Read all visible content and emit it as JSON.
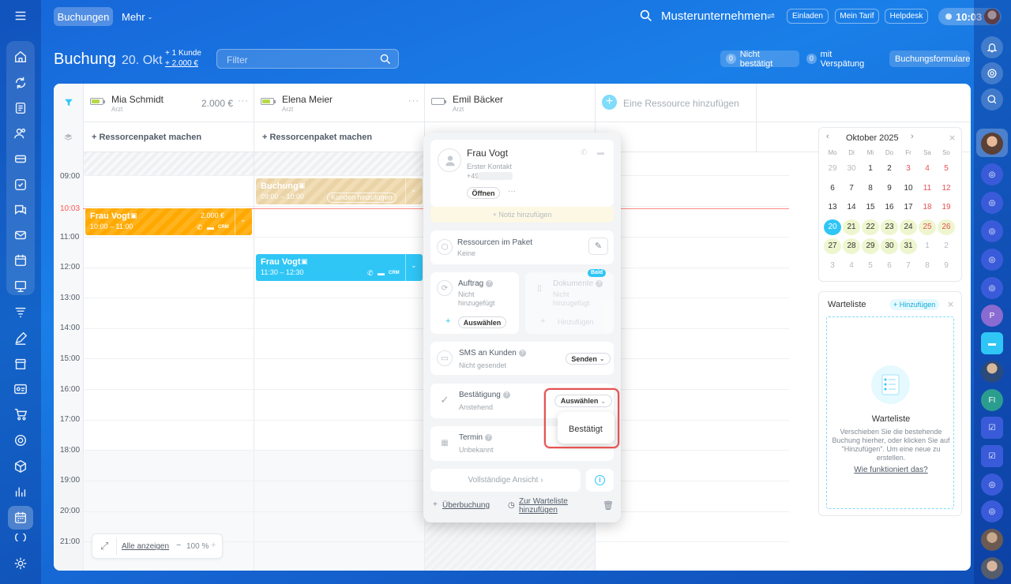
{
  "topbar": {
    "tab_active": "Buchungen",
    "tab_more": "Mehr",
    "company": "Musterunternehmen",
    "invite": "Einladen",
    "plan": "Mein Tarif",
    "helpdesk": "Helpdesk",
    "clock": "10:03"
  },
  "header": {
    "title": "Buchung",
    "date": "20. Okt",
    "stat1": "+ 1 Kunde",
    "stat2": "+ 2.000 €",
    "filter_placeholder": "Filter",
    "not_confirmed_count": "0",
    "not_confirmed": "Nicht bestätigt",
    "late_count": "0",
    "late": "mit Verspätung",
    "forms": "Buchungsformulare"
  },
  "resources": [
    {
      "name": "Mia Schmidt",
      "role": "Arzt",
      "amount": "2.000 €"
    },
    {
      "name": "Elena Meier",
      "role": "Arzt"
    },
    {
      "name": "Emil Bäcker",
      "role": "Arzt"
    }
  ],
  "add_resource": "Eine Ressource hinzufügen",
  "package_label": "+ Ressorcenpaket machen",
  "times": [
    "09:00",
    "10:03",
    "11:00",
    "12:00",
    "13:00",
    "14:00",
    "15:00",
    "16:00",
    "17:00",
    "18:00",
    "19:00",
    "20:00",
    "21:00"
  ],
  "current_time": "10:03",
  "bookings": {
    "vogt1": {
      "title": "Frau Vogt",
      "time": "10:00 – 11:00",
      "amount": "2.000 €",
      "crm": "CRM"
    },
    "buchung": {
      "title": "Buchung",
      "time": "09:00 – 10:00",
      "action": "Kunden hinzufügen"
    },
    "vogt2": {
      "title": "Frau Vogt",
      "time": "11:30 – 12:30",
      "crm": "CRM"
    }
  },
  "footer": {
    "show_all": "Alle anzeigen",
    "zoom": "100 %"
  },
  "popup": {
    "client_name": "Frau Vogt",
    "client_status": "Erster Kontakt",
    "client_phone": "+49",
    "open_btn": "Öffnen",
    "add_note": "+ Notiz hinzufügen",
    "res_pkg_title": "Ressourcen im Paket",
    "res_pkg_value": "Keine",
    "order_title": "Auftrag",
    "order_value": "Nicht hinzugefügt",
    "order_btn": "Auswählen",
    "docs_title": "Dokumente",
    "docs_value": "Nicht hinzugefügt",
    "docs_btn": "Hinzufügen",
    "docs_badge": "Bald",
    "sms_title": "SMS an Kunden",
    "sms_value": "Nicht gesendet",
    "sms_btn": "Senden",
    "confirm_title": "Bestätigung",
    "confirm_value": "Anstehend",
    "confirm_btn": "Auswählen",
    "confirm_option": "Bestätigt",
    "term_title": "Termin",
    "term_value": "Unbekannt",
    "full_view": "Vollständige Ansicht",
    "overbooking": "Überbuchung",
    "waitlist_add": "Zur Warteliste hinzufügen"
  },
  "calendar": {
    "month": "Oktober 2025",
    "weekdays": [
      "Mo",
      "Di",
      "Mi",
      "Do",
      "Fr",
      "Sa",
      "So"
    ],
    "weeks": [
      [
        "29",
        "30",
        "1",
        "2",
        "3",
        "4",
        "5"
      ],
      [
        "6",
        "7",
        "8",
        "9",
        "10",
        "11",
        "12"
      ],
      [
        "13",
        "14",
        "15",
        "16",
        "17",
        "18",
        "19"
      ],
      [
        "20",
        "21",
        "22",
        "23",
        "24",
        "25",
        "26"
      ],
      [
        "27",
        "28",
        "29",
        "30",
        "31",
        "1",
        "2"
      ],
      [
        "3",
        "4",
        "5",
        "6",
        "7",
        "8",
        "9"
      ]
    ]
  },
  "waitlist": {
    "title": "Warteliste",
    "add": "+ Hinzufügen",
    "empty_title": "Warteliste",
    "empty_text": "Verschieben Sie die bestehende Buchung hierher, oder klicken Sie auf \"Hinzufügen\". Um eine neue zu erstellen.",
    "link": "Wie funktioniert das?"
  },
  "right_sidebar": {
    "avatar_p": "P",
    "avatar_fi": "FI"
  },
  "colors": {
    "accent": "#2fc6f6",
    "orange": "#ffa900",
    "current_time_line": "#ff5752",
    "highlight": "#e55353"
  }
}
